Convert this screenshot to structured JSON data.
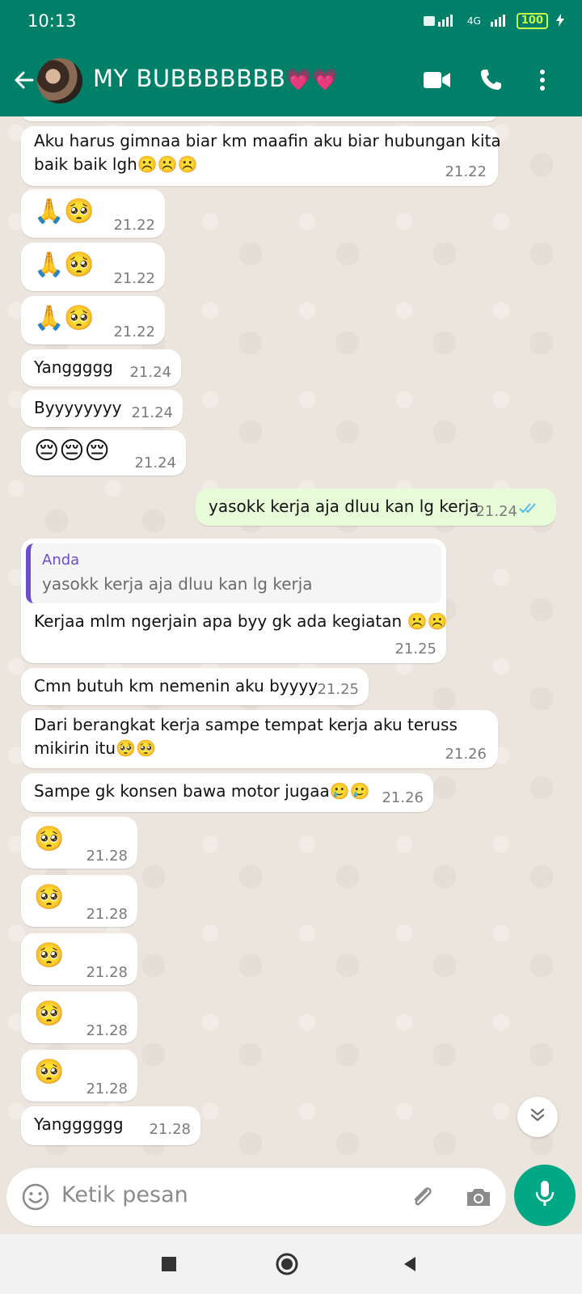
{
  "status": {
    "time": "10:13",
    "network": "4G",
    "battery": "100"
  },
  "header": {
    "contact_name": "MY BUBBBBBBB",
    "contact_hearts": "💗💗"
  },
  "messages": [
    {
      "text": "Aku harus gimnaa biar km maafin aku biar hubungan kita",
      "text2": "baik baik lgh☹️☹️☹️",
      "time": "21.22"
    },
    {
      "text": "🙏🥺",
      "time": "21.22"
    },
    {
      "text": "🙏🥺",
      "time": "21.22"
    },
    {
      "text": "🙏🥺",
      "time": "21.22"
    },
    {
      "text": "Yanggggg",
      "time": "21.24"
    },
    {
      "text": "Byyyyyyyy",
      "time": "21.24"
    },
    {
      "text": "😔😔😔",
      "time": "21.24"
    },
    {
      "text": "yasokk kerja aja dluu kan lg kerja",
      "time": "21.24"
    },
    {
      "quote_name": "Anda",
      "quote_text": "yasokk kerja aja dluu kan lg kerja",
      "text": "Kerjaa mlm ngerjain apa byy gk ada kegiatan ☹️☹️",
      "time": "21.25"
    },
    {
      "text": "Cmn butuh km nemenin aku byyyy",
      "time": "21.25"
    },
    {
      "text": "Dari berangkat kerja sampe tempat kerja aku teruss",
      "text2": "mikirin itu🥺🥺",
      "time": "21.26"
    },
    {
      "text": "Sampe gk konsen bawa motor jugaa🥲🥲",
      "time": "21.26"
    },
    {
      "text": "🥺",
      "time": "21.28"
    },
    {
      "text": "🥺",
      "time": "21.28"
    },
    {
      "text": "🥺",
      "time": "21.28"
    },
    {
      "text": "🥺",
      "time": "21.28"
    },
    {
      "text": "🥺",
      "time": "21.28"
    },
    {
      "text": "Yangggggg",
      "time": "21.28"
    }
  ],
  "input": {
    "placeholder": "Ketik pesan"
  },
  "colors": {
    "header": "#008069",
    "chat_bg": "#ece5dd",
    "outgoing": "#e7fbd9",
    "fab": "#00a884",
    "quote_accent": "#6c4ccf"
  }
}
